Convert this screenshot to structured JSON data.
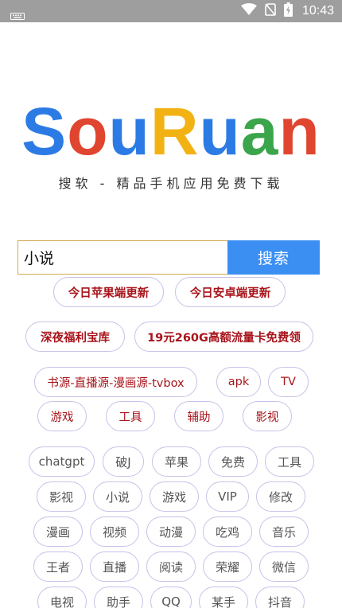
{
  "status_bar": {
    "time": "10:43",
    "icons": [
      "keyboard-icon",
      "wifi-icon",
      "no-sim-icon",
      "battery-charging-icon"
    ]
  },
  "brand": {
    "logo_parts": [
      {
        "text": "S",
        "color": "#2c7be5"
      },
      {
        "text": "o",
        "color": "#e0452f"
      },
      {
        "text": "u",
        "color": "#2c7be5"
      },
      {
        "text": "R",
        "color": "#f3b214"
      },
      {
        "text": "u",
        "color": "#2c7be5"
      },
      {
        "text": "a",
        "color": "#3aa54b"
      },
      {
        "text": "n",
        "color": "#e0452f"
      }
    ],
    "tagline": "搜软 - 精品手机应用免费下载"
  },
  "search": {
    "value": "小说",
    "button_label": "搜索"
  },
  "promo_links": [
    "今日苹果端更新",
    "今日安卓端更新",
    "深夜福利宝库",
    "19元260G高额流量卡免费领"
  ],
  "keyword_links": [
    "书源-直播源-漫画源-tvbox",
    "apk",
    "TV",
    "游戏",
    "工具",
    "辅助",
    "影视"
  ],
  "tags": [
    "chatgpt",
    "破J",
    "苹果",
    "免费",
    "工具",
    "影视",
    "小说",
    "游戏",
    "VIP",
    "修改",
    "漫画",
    "视频",
    "动漫",
    "吃鸡",
    "音乐",
    "王者",
    "直播",
    "阅读",
    "荣耀",
    "微信",
    "电视",
    "助手",
    "QQ",
    "某手",
    "抖音"
  ],
  "colors": {
    "accent": "#3b8ff2",
    "input_border": "#d4a84b",
    "hot_text": "#a8141b",
    "pill_border": "#c7c2e8",
    "status_bar": "#9e9e9e"
  }
}
